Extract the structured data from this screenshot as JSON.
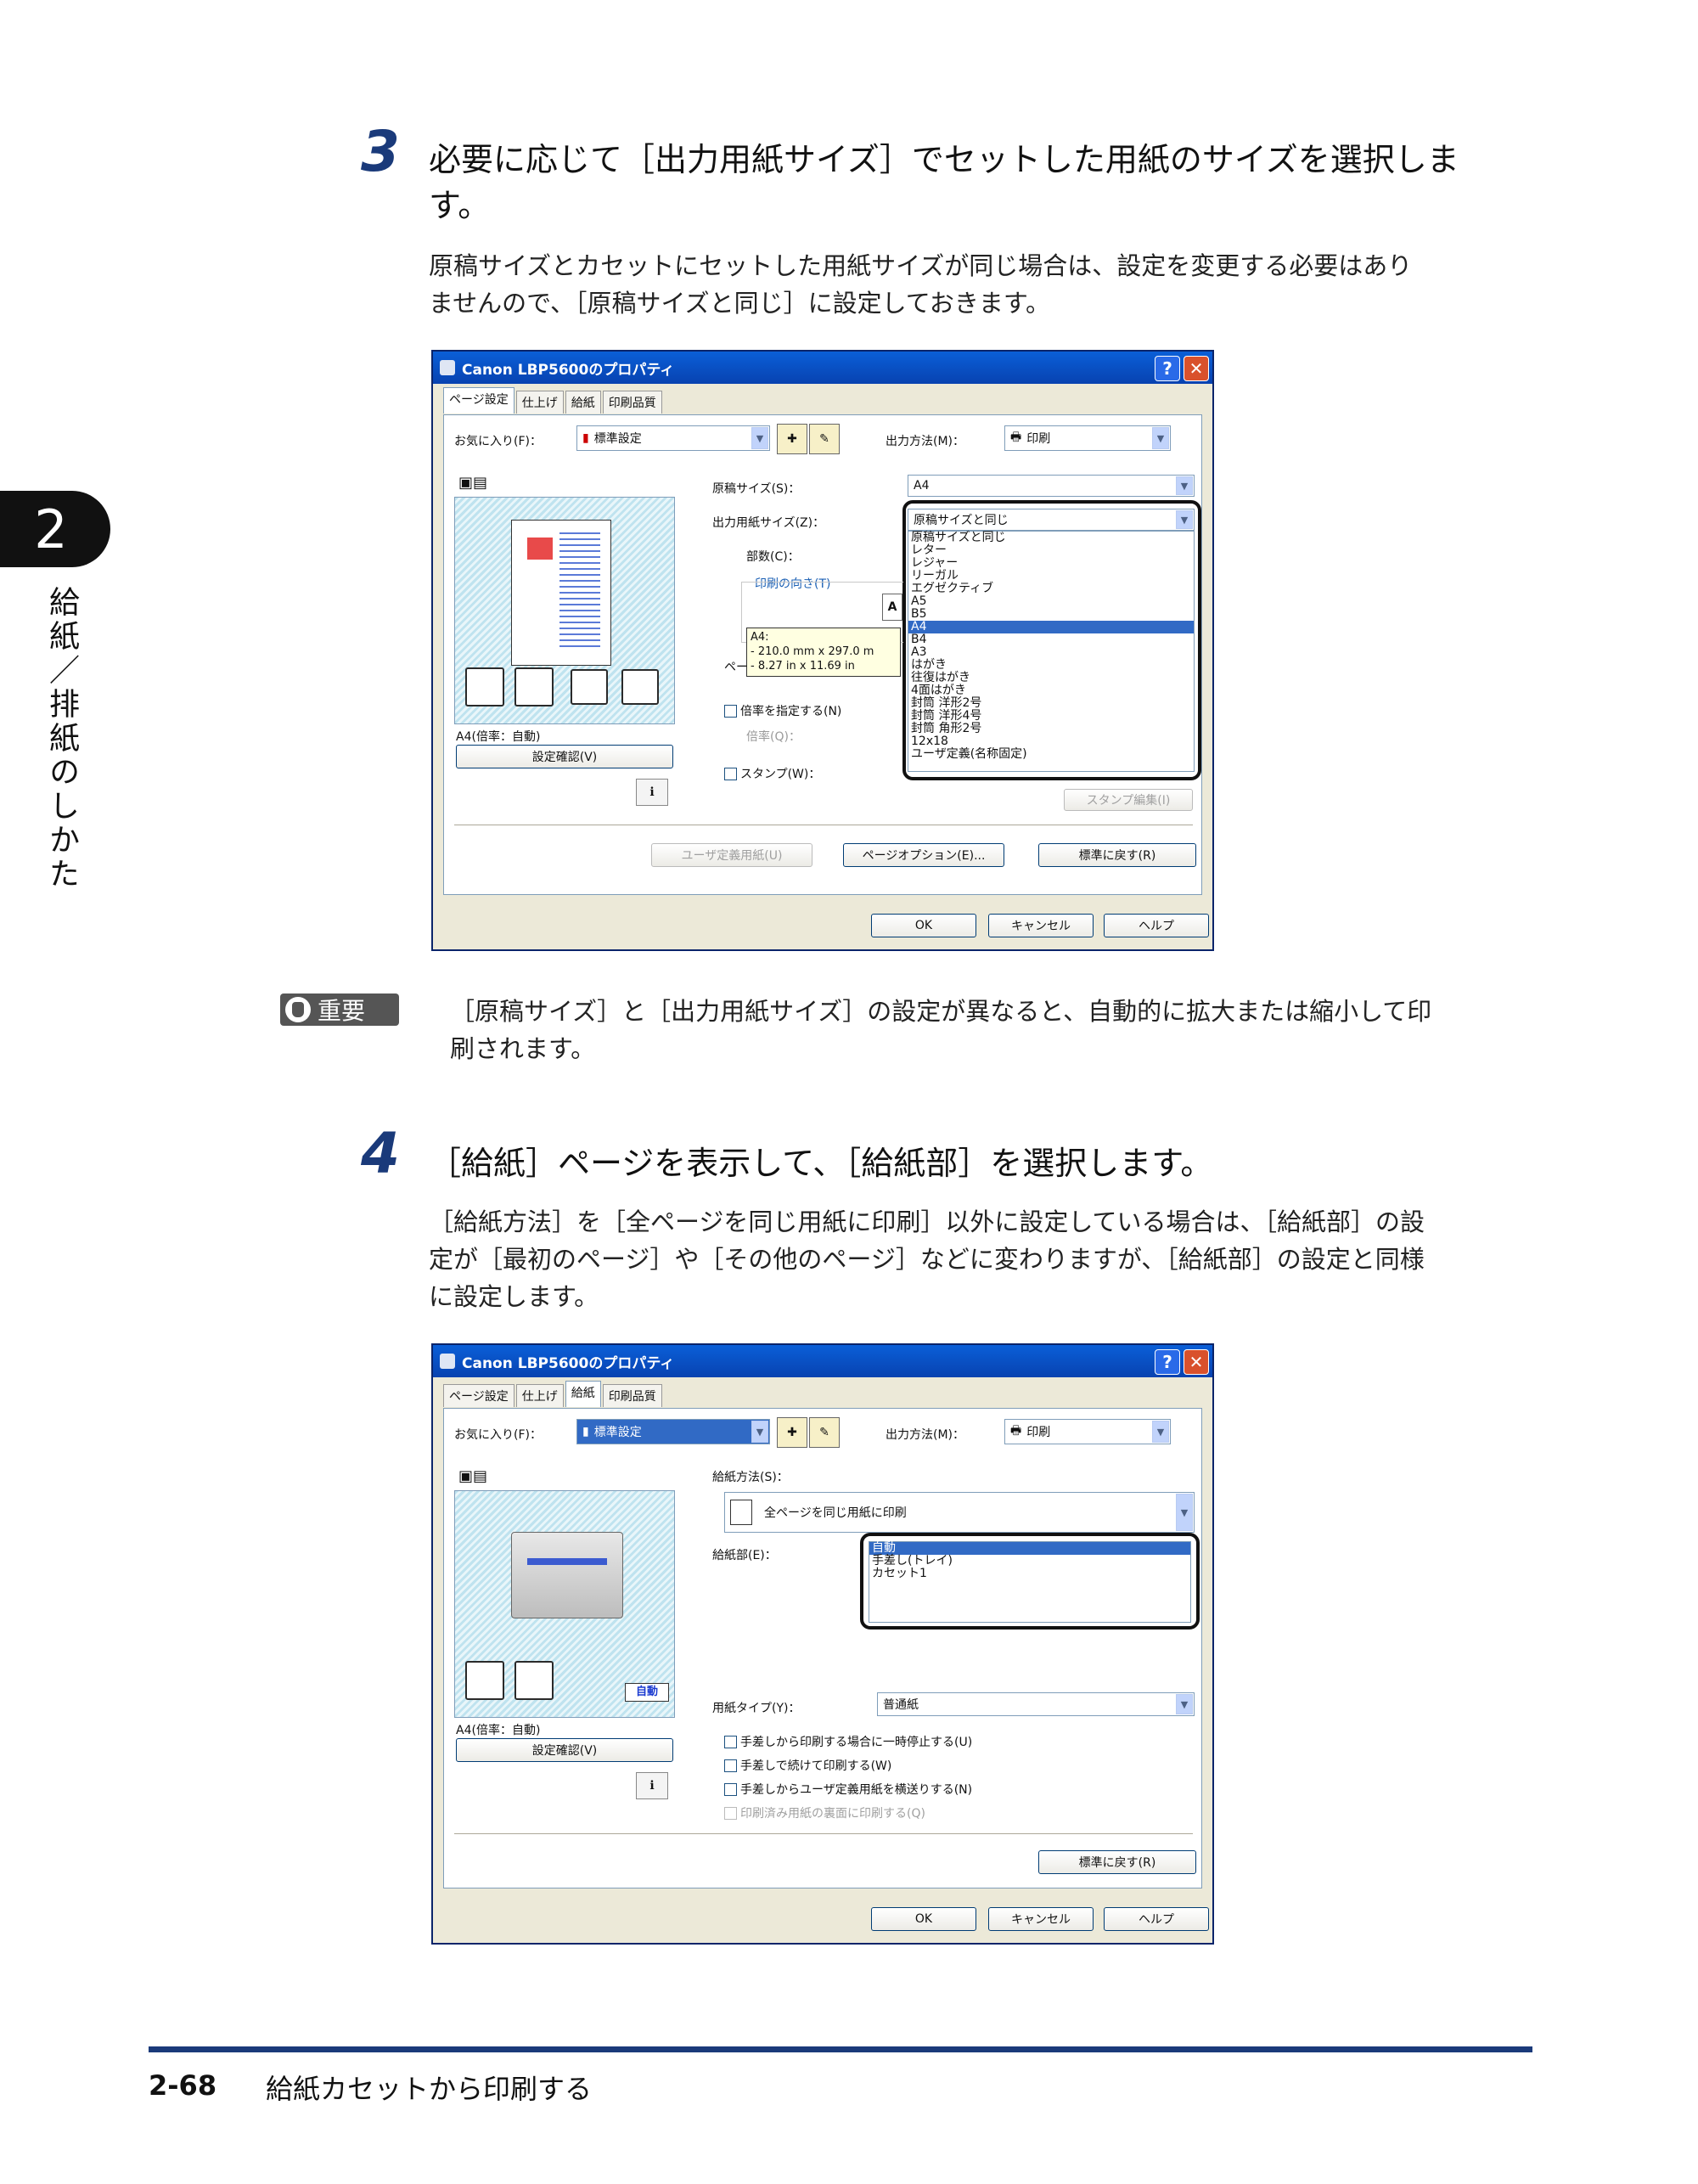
{
  "sidebar": {
    "chapter_number": "2",
    "chapter_title": "給紙／排紙のしかた"
  },
  "step3": {
    "number": "3",
    "title_line1": "必要に応じて［出力用紙サイズ］でセットした用紙のサイズを選択しま",
    "title_line2": "す。",
    "body_line1": "原稿サイズとカセットにセットした用紙サイズが同じ場合は、設定を変更する必要はあり",
    "body_line2": "ませんので、［原稿サイズと同じ］に設定しておきます。"
  },
  "dialog1": {
    "title": "Canon LBP5600のプロパティ",
    "tabs": [
      "ページ設定",
      "仕上げ",
      "給紙",
      "印刷品質"
    ],
    "favorites_label": "お気に入り(F)：",
    "favorites_value": "標準設定",
    "output_method_label": "出力方法(M)：",
    "output_method_value": "印刷",
    "page_size_label": "原稿サイズ(S)：",
    "page_size_value": "A4",
    "output_size_label": "出力用紙サイズ(Z)：",
    "output_size_value": "原稿サイズと同じ",
    "copies_label": "部数(C)：",
    "orientation_label": "印刷の向き(T)",
    "tooltip_lines": [
      "A4:",
      "- 210.0 mm x 297.0 m",
      "- 8.27 in x 11.69 in"
    ],
    "page_layout_partial": "ペー",
    "scaling_label": "倍率を指定する(N)",
    "scaling_value_label": "倍率(Q)：",
    "stamp_label": "スタンプ(W)：",
    "stamp_edit_button": "スタンプ編集(I)",
    "preview_caption": "A4(倍率：自動)",
    "settings_confirm_button": "設定確認(V)",
    "custom_paper_button": "ユーザ定義用紙(U)",
    "page_options_button": "ページオプション(E)...",
    "restore_defaults_button": "標準に戻す(R)",
    "ok_button": "OK",
    "cancel_button": "キャンセル",
    "help_button": "ヘルプ",
    "size_options": [
      "原稿サイズと同じ",
      "レター",
      "レジャー",
      "リーガル",
      "エグゼクティブ",
      "A5",
      "B5",
      "A4",
      "B4",
      "A3",
      "はがき",
      "往復はがき",
      "4面はがき",
      "封筒 洋形2号",
      "封筒 洋形4号",
      "封筒 角形2号",
      "12x18",
      "ユーザ定義(名称固定)"
    ],
    "selected_option": "A4"
  },
  "important": {
    "badge": "重要",
    "line1": "［原稿サイズ］と［出力用紙サイズ］の設定が異なると、自動的に拡大または縮小して印",
    "line2": "刷されます。"
  },
  "step4": {
    "number": "4",
    "title": "［給紙］ページを表示して、［給紙部］を選択します。",
    "body_line1": "［給紙方法］を［全ページを同じ用紙に印刷］以外に設定している場合は、［給紙部］の設",
    "body_line2": "定が［最初のページ］や［その他のページ］などに変わりますが、［給紙部］の設定と同様",
    "body_line3": "に設定します。"
  },
  "dialog2": {
    "title": "Canon LBP5600のプロパティ",
    "tabs": [
      "ページ設定",
      "仕上げ",
      "給紙",
      "印刷品質"
    ],
    "favorites_label": "お気に入り(F)：",
    "favorites_value": "標準設定",
    "output_method_label": "出力方法(M)：",
    "output_method_value": "印刷",
    "feed_method_label": "給紙方法(S)：",
    "feed_method_value": "全ページを同じ用紙に印刷",
    "paper_source_label": "給紙部(E)：",
    "source_options": [
      "自動",
      "手差し(トレイ)",
      "カセット1"
    ],
    "selected_source": "自動",
    "paper_type_label": "用紙タイプ(Y)：",
    "paper_type_value": "普通紙",
    "auto_badge": "自動",
    "checkboxes": [
      "手差しから印刷する場合に一時停止する(U)",
      "手差しで続けて印刷する(W)",
      "手差しからユーザ定義用紙を横送りする(N)",
      "印刷済み用紙の裏面に印刷する(Q)"
    ],
    "preview_caption": "A4(倍率：自動)",
    "settings_confirm_button": "設定確認(V)",
    "restore_defaults_button": "標準に戻す(R)",
    "ok_button": "OK",
    "cancel_button": "キャンセル",
    "help_button": "ヘルプ"
  },
  "footer": {
    "page_number": "2-68",
    "title": "給紙カセットから印刷する"
  },
  "colors": {
    "accent": "#1a3a7a",
    "selection": "#316ac5",
    "titlebar": "#0a5fd8"
  }
}
